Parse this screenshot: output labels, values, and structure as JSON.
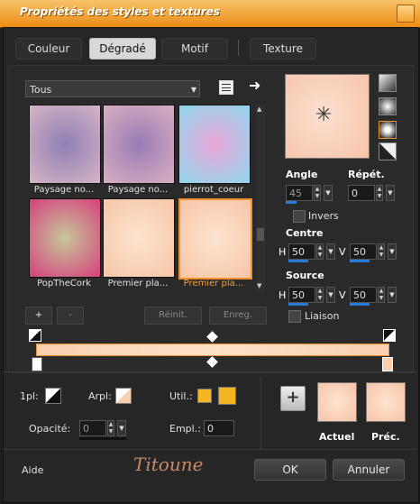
{
  "window": {
    "title": "Propriétés des styles et textures"
  },
  "tabs": [
    {
      "label": "Couleur",
      "active": false
    },
    {
      "label": "Dégradé",
      "active": true
    },
    {
      "label": "Motif",
      "active": false
    },
    {
      "label": "Texture",
      "active": false
    }
  ],
  "category": {
    "selected": "Tous"
  },
  "gallery": {
    "items": [
      {
        "label": "Paysage no...",
        "selected": false,
        "colors": [
          "#8f7fb4",
          "#d6b4c4"
        ]
      },
      {
        "label": "Paysage no...",
        "selected": false,
        "colors": [
          "#9a7bb5",
          "#d8b0c0"
        ]
      },
      {
        "label": "pierrot_coeur",
        "selected": false,
        "colors": [
          "#eaa6d6",
          "#8fd8ee"
        ]
      },
      {
        "label": "PopTheCork",
        "selected": false,
        "colors": [
          "#c8c89a",
          "#d4407c"
        ]
      },
      {
        "label": "Premier pla...",
        "selected": false,
        "colors": [
          "#fde4d0",
          "#f6c6a6"
        ]
      },
      {
        "label": "Premier pla...",
        "selected": true,
        "colors": [
          "#fde4d0",
          "#f6c6a6"
        ]
      }
    ],
    "add_label": "+",
    "remove_label": "-",
    "reset_label": "Réinit.",
    "save_label": "Enreg."
  },
  "gradient": {
    "angle_label": "Angle",
    "angle_value": "45",
    "repeat_label": "Répét.",
    "repeat_value": "0",
    "invert_label": "Invers",
    "center_label": "Centre",
    "center_h_label": "H",
    "center_h": "50",
    "center_v_label": "V",
    "center_v": "50",
    "source_label": "Source",
    "source_h_label": "H",
    "source_h": "50",
    "source_v_label": "V",
    "source_v": "50",
    "link_label": "Liaison",
    "invert_checked": false,
    "link_checked": false
  },
  "bottom": {
    "first_plan_label": "1pl:",
    "back_plan_label": "Arpl:",
    "use_label": "Util.:",
    "opacity_label": "Opacité:",
    "opacity_value": "0",
    "location_label": "Empl.:",
    "location_value": "0",
    "current_label": "Actuel",
    "previous_label": "Préc.",
    "add_label": "+"
  },
  "footer": {
    "help_label": "Aide",
    "ok_label": "OK",
    "cancel_label": "Annuler",
    "signature": "Titoune"
  },
  "colors": {
    "accent": "#f09030",
    "gradient_fg": "#fbd0b0",
    "gradient_bg": "#fde2c8",
    "use_swatch": "#f3b520",
    "slider_blue": "#2a7bd8"
  }
}
